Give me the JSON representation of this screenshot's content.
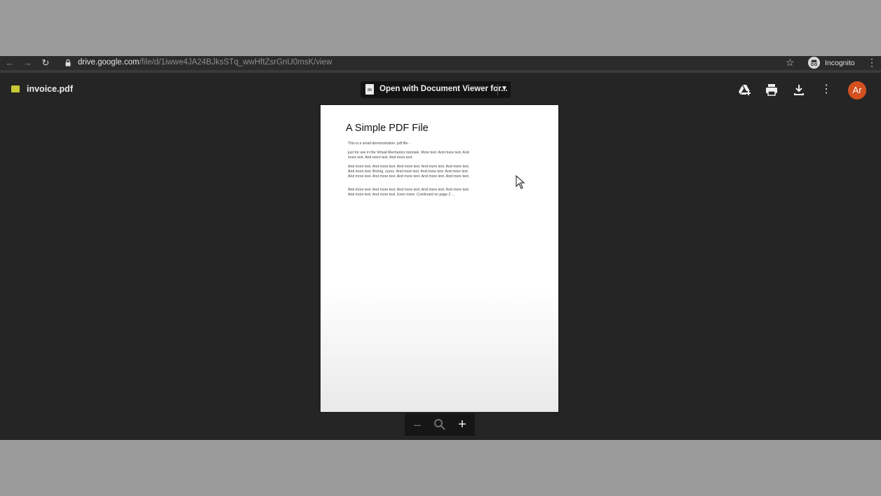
{
  "browser": {
    "url_host": "drive.google.com",
    "url_path": "/file/d/1iwwe4JA24BJksSTq_wwHftZsrGnU0msK/view",
    "incognito_label": "Incognito",
    "icons": [
      "back-icon",
      "forward-icon",
      "reload-icon",
      "lock-icon",
      "star-icon",
      "incognito-icon",
      "menu-icon"
    ]
  },
  "drive": {
    "file_name": "invoice.pdf",
    "open_with_label": "Open with Document Viewer for...",
    "avatar_initials": "Ar",
    "avatar_color": "#d4501f",
    "file_icon_color": "#c8c934",
    "actions": [
      "add-to-drive-icon",
      "print-icon",
      "download-icon",
      "more-icon"
    ]
  },
  "pdf": {
    "title": "A Simple PDF File",
    "paragraphs": [
      "This is a small demonstration .pdf file -",
      "just for use in the Virtual Mechanics tutorials. More text. And more text. And more text. And more text. And more text.",
      "And more text. And more text. And more text. And more text. And more text. And more text. Boring, zzzzz. And more text. And more text. And more text. And more text. And more text. And more text. And more text. And more text.",
      "And more text. And more text. And more text. And more text. And more text. And more text. And more text. Even more. Continued on page 2 ..."
    ]
  },
  "zoom": {
    "out_icon": "zoom-out-icon",
    "magnifier_icon": "magnifier-icon",
    "in_icon": "zoom-in-icon"
  }
}
